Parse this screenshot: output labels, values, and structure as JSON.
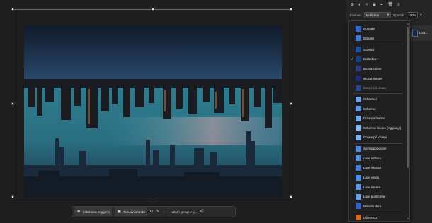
{
  "taskbar": {
    "select_subject": "Seleziona soggetto",
    "remove_background": "Rimuovi sfondo",
    "more": "···",
    "generative": "allarn group 4 g..."
  },
  "options": {
    "blend_label": "Fusione:",
    "blend_value": "Moltiplica",
    "opacity_label": "Opacità:",
    "opacity_value": "100%"
  },
  "layer": {
    "name": "Liv1..."
  },
  "blend_modes": [
    {
      "label": "Normale",
      "checked": false,
      "dim": false,
      "color": "#2a6ad8"
    },
    {
      "label": "Dissolvi",
      "checked": false,
      "dim": false,
      "color": "#3b78d8"
    },
    {
      "label": "Scurisci",
      "checked": false,
      "dim": false,
      "color": "#1d4fa3"
    },
    {
      "label": "Moltiplica",
      "checked": true,
      "dim": false,
      "color": "#1c3f86"
    },
    {
      "label": "Brucia colore",
      "checked": false,
      "dim": false,
      "color": "#253a83"
    },
    {
      "label": "Brucia lineare",
      "checked": false,
      "dim": false,
      "color": "#1a2d6e"
    },
    {
      "label": "Colore più scuro",
      "checked": false,
      "dim": true,
      "color": "#27448f"
    },
    {
      "label": "Schiarisci",
      "checked": false,
      "dim": false,
      "color": "#6aa0ec"
    },
    {
      "label": "Schermo",
      "checked": false,
      "dim": false,
      "color": "#5c96e6"
    },
    {
      "label": "Colore schermo",
      "checked": false,
      "dim": false,
      "color": "#74aaf0"
    },
    {
      "label": "Schermo lineare (Aggiungi)",
      "checked": false,
      "dim": false,
      "color": "#86b8f4"
    },
    {
      "label": "Colore più chiaro",
      "checked": false,
      "dim": false,
      "color": "#7db2f0"
    },
    {
      "label": "Sovrapposizione",
      "checked": false,
      "dim": false,
      "color": "#4a85de"
    },
    {
      "label": "Luce soffusa",
      "checked": false,
      "dim": false,
      "color": "#5690e2"
    },
    {
      "label": "Luce intensa",
      "checked": false,
      "dim": false,
      "color": "#3f7ad8"
    },
    {
      "label": "Luce vivida",
      "checked": false,
      "dim": false,
      "color": "#4a8ee8"
    },
    {
      "label": "Luce lineare",
      "checked": false,
      "dim": false,
      "color": "#5a9aee"
    },
    {
      "label": "Luce puntiforme",
      "checked": false,
      "dim": false,
      "color": "#6aa2ee"
    },
    {
      "label": "Miscela dura",
      "checked": false,
      "dim": false,
      "color": "#2d62c6"
    },
    {
      "label": "Differenza",
      "checked": false,
      "dim": false,
      "color": "#d86a1e"
    }
  ],
  "colors": {
    "app_bg": "#1e1e1e",
    "panel_bg": "#252525",
    "accent": "#2a6ad8"
  }
}
